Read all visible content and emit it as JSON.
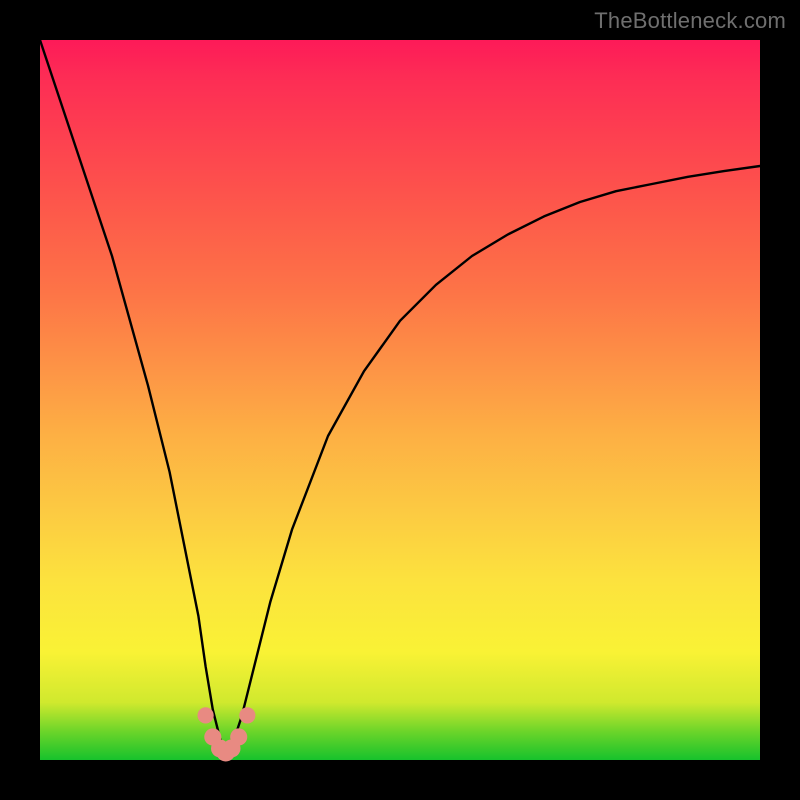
{
  "watermark": "TheBottleneck.com",
  "chart_data": {
    "type": "line",
    "title": "",
    "xlabel": "",
    "ylabel": "",
    "xlim": [
      0,
      100
    ],
    "ylim": [
      0,
      100
    ],
    "grid": false,
    "legend": false,
    "series": [
      {
        "name": "curve",
        "color": "#000000",
        "x": [
          0,
          5,
          10,
          15,
          18,
          20,
          22,
          23,
          24,
          25,
          25.5,
          26,
          26.5,
          27,
          28,
          29,
          30,
          32,
          35,
          40,
          45,
          50,
          55,
          60,
          65,
          70,
          75,
          80,
          85,
          90,
          95,
          100
        ],
        "y": [
          100,
          85,
          70,
          52,
          40,
          30,
          20,
          13,
          7,
          3,
          1.5,
          1,
          1.5,
          3,
          6,
          10,
          14,
          22,
          32,
          45,
          54,
          61,
          66,
          70,
          73,
          75.5,
          77.5,
          79,
          80,
          81,
          81.8,
          82.5
        ]
      }
    ],
    "markers": {
      "name": "trough-dots",
      "color": "#e88a82",
      "x": [
        23.0,
        24.0,
        25.0,
        25.8,
        26.6,
        27.6,
        28.8
      ],
      "y": [
        6.2,
        3.2,
        1.6,
        1.1,
        1.6,
        3.2,
        6.2
      ],
      "size_scale": [
        0.9,
        0.95,
        1.0,
        1.05,
        1.0,
        0.95,
        0.9
      ]
    },
    "background_gradient": {
      "type": "vertical",
      "stops": [
        {
          "pos": 0.0,
          "color": "#16c22c"
        },
        {
          "pos": 0.08,
          "color": "#d0e92e"
        },
        {
          "pos": 0.25,
          "color": "#fce23e"
        },
        {
          "pos": 0.55,
          "color": "#fd9246"
        },
        {
          "pos": 0.85,
          "color": "#fd444f"
        },
        {
          "pos": 1.0,
          "color": "#fd1a58"
        }
      ]
    }
  }
}
